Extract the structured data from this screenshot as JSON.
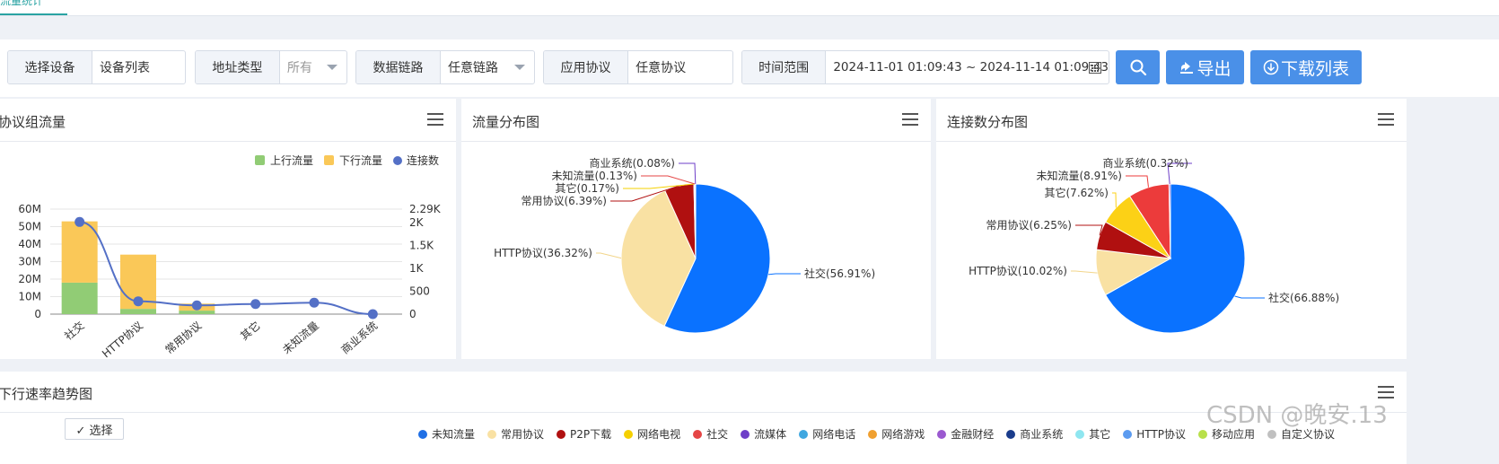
{
  "top_tab": {
    "label": "流量统计"
  },
  "filters": {
    "device": {
      "label": "选择设备",
      "value": "设备列表"
    },
    "address_type": {
      "label": "地址类型",
      "value": "所有"
    },
    "data_link": {
      "label": "数据链路",
      "value": "任意链路"
    },
    "app_protocol": {
      "label": "应用协议",
      "value": "任意协议"
    },
    "time_range": {
      "label": "时间范围",
      "value": "2024-11-01 01:09:43 ~ 2024-11-14 01:09:43"
    }
  },
  "buttons": {
    "search_icon": "search-icon",
    "export_label": "导出",
    "download_label": "下载列表"
  },
  "panels": {
    "protocol_group": {
      "title": "协议组流量",
      "legend": {
        "up": "上行流量",
        "down": "下行流量",
        "conn": "连接数"
      }
    },
    "traffic_dist": {
      "title": "流量分布图"
    },
    "conn_dist": {
      "title": "连接数分布图"
    },
    "rate_trend": {
      "title": "下行速率趋势图",
      "select_label": "✓ 选择"
    }
  },
  "chart_data": [
    {
      "type": "bar",
      "categories": [
        "社交",
        "HTTP协议",
        "常用协议",
        "其它",
        "未知流量",
        "商业系统"
      ],
      "series": [
        {
          "name": "上行流量",
          "values": [
            18,
            3,
            2,
            0,
            0,
            0
          ]
        },
        {
          "name": "下行流量",
          "values": [
            35,
            31,
            4,
            0,
            0,
            0
          ]
        },
        {
          "name": "连接数",
          "values": [
            2010,
            280,
            190,
            220,
            250,
            0
          ]
        }
      ],
      "y_ticks": [
        "0",
        "10M",
        "20M",
        "30M",
        "40M",
        "50M",
        "60M"
      ],
      "y2_ticks": [
        "0",
        "500",
        "1K",
        "1.5K",
        "2K",
        "2.29K"
      ],
      "ylim": [
        0,
        60
      ],
      "y2lim": [
        0,
        2290
      ],
      "colors": {
        "up": "#91cc75",
        "down": "#fac858",
        "conn": "#5470c6"
      }
    },
    {
      "type": "pie",
      "slices": [
        {
          "label": "社交(56.91%)",
          "value": 56.91,
          "color": "#0a72ff"
        },
        {
          "label": "HTTP协议(36.32%)",
          "value": 36.32,
          "color": "#f9e1a3"
        },
        {
          "label": "常用协议(6.39%)",
          "value": 6.39,
          "color": "#b01010"
        },
        {
          "label": "其它(0.17%)",
          "value": 0.17,
          "color": "#f5d000"
        },
        {
          "label": "未知流量(0.13%)",
          "value": 0.13,
          "color": "#e54545"
        },
        {
          "label": "商业系统(0.08%)",
          "value": 0.08,
          "color": "#6e3fc8"
        }
      ]
    },
    {
      "type": "pie",
      "slices": [
        {
          "label": "社交(66.88%)",
          "value": 66.88,
          "color": "#0a72ff"
        },
        {
          "label": "HTTP协议(10.02%)",
          "value": 10.02,
          "color": "#f9e1a3"
        },
        {
          "label": "常用协议(6.25%)",
          "value": 6.25,
          "color": "#b01010"
        },
        {
          "label": "其它(7.62%)",
          "value": 7.62,
          "color": "#fcd116"
        },
        {
          "label": "未知流量(8.91%)",
          "value": 8.91,
          "color": "#ec3b3b"
        },
        {
          "label": "商业系统(0.32%)",
          "value": 0.32,
          "color": "#6e3fc8"
        }
      ]
    }
  ],
  "bottom_legend": [
    {
      "label": "未知流量",
      "color": "#1f6fe5"
    },
    {
      "label": "常用协议",
      "color": "#f9e1a3"
    },
    {
      "label": "P2P下载",
      "color": "#b01010"
    },
    {
      "label": "网络电视",
      "color": "#f5d000"
    },
    {
      "label": "社交",
      "color": "#e54545"
    },
    {
      "label": "流媒体",
      "color": "#6e3fc8"
    },
    {
      "label": "网络电话",
      "color": "#3fa7e0"
    },
    {
      "label": "网络游戏",
      "color": "#f0a030"
    },
    {
      "label": "金融财经",
      "color": "#9b59d0"
    },
    {
      "label": "商业系统",
      "color": "#1a3c8c"
    },
    {
      "label": "其它",
      "color": "#8fe6f0"
    },
    {
      "label": "HTTP协议",
      "color": "#5b9bf0"
    },
    {
      "label": "移动应用",
      "color": "#b8e04a"
    },
    {
      "label": "自定义协议",
      "color": "#c0c0c0"
    }
  ],
  "watermark": "CSDN @晚安.13"
}
